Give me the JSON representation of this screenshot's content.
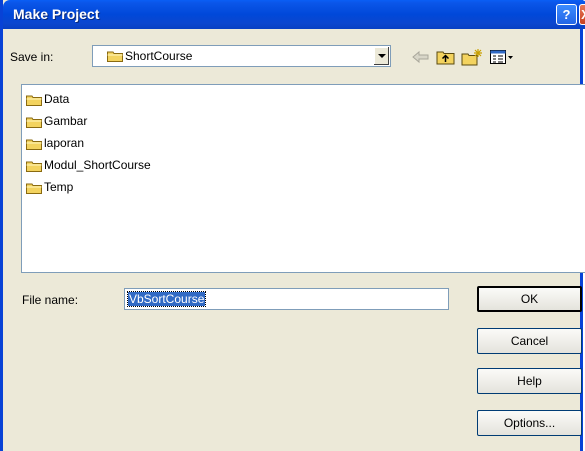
{
  "window": {
    "title": "Make Project",
    "help_glyph": "?",
    "close_glyph": "X"
  },
  "save_in": {
    "label": "Save in:",
    "value": "ShortCourse"
  },
  "toolbar": {
    "icons": [
      "back-arrow-icon",
      "up-folder-icon",
      "new-folder-icon",
      "view-menu-icon"
    ]
  },
  "files": [
    {
      "name": "Data"
    },
    {
      "name": "Gambar"
    },
    {
      "name": "laporan"
    },
    {
      "name": "Modul_ShortCourse"
    },
    {
      "name": "Temp"
    }
  ],
  "file_name": {
    "label": "File name:",
    "value": "VbSortCourse"
  },
  "buttons": {
    "ok": "OK",
    "cancel": "Cancel",
    "help": "Help",
    "options": "Options..."
  },
  "colors": {
    "titlebar": "#0048d9",
    "dialog_bg": "#ece9d8",
    "selection": "#316ac5",
    "folder": "#f3d35f"
  }
}
